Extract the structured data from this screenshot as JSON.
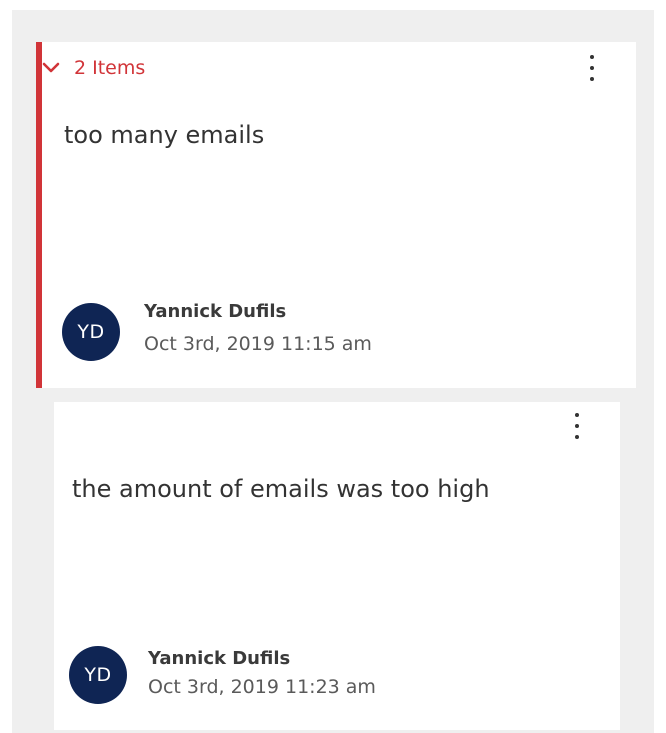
{
  "colors": {
    "accent": "#d13438",
    "avatar_bg": "#0f2554",
    "panel_bg": "#efefef"
  },
  "thread": {
    "group_toggle": {
      "label": "2 Items",
      "icon": "chevron-down-icon"
    },
    "more_icon": "more-vertical-icon",
    "main_comment": {
      "text": "too many emails",
      "author": "Yannick Dufils",
      "initials": "YD",
      "timestamp": "Oct 3rd, 2019 11:15 am"
    },
    "reply": {
      "text": "the amount of emails was too high",
      "author": "Yannick Dufils",
      "initials": "YD",
      "timestamp": "Oct 3rd, 2019 11:23 am"
    }
  }
}
